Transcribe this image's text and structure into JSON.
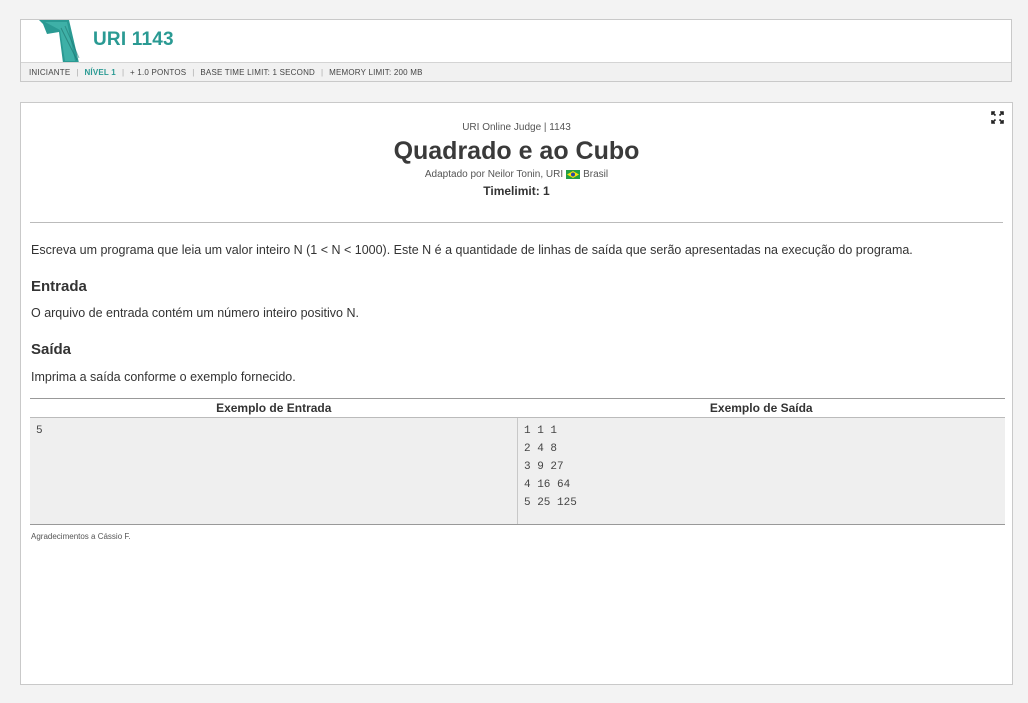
{
  "header": {
    "problem_id": "URI 1143",
    "meta": {
      "category": "INICIANTE",
      "level": "NÍVEL 1",
      "points": "+ 1.0 PONTOS",
      "time_limit": "BASE TIME LIMIT: 1 SECOND",
      "memory_limit": "MEMORY LIMIT: 200 MB"
    },
    "logo_icon": "uri-1-logo"
  },
  "problem": {
    "judge_line": "URI Online Judge | 1143",
    "title": "Quadrado e ao Cubo",
    "author_prefix": "Adaptado por Neilor Tonin, URI",
    "country": "Brasil",
    "flag_icon": "brazil-flag-icon",
    "timelimit": "Timelimit: 1",
    "description": "Escreva um programa que leia um valor inteiro N (1 < N < 1000). Este N é a quantidade de linhas de saída que serão apresentadas na execução do programa.",
    "input_heading": "Entrada",
    "input_text": "O arquivo de entrada contém um número inteiro positivo N.",
    "output_heading": "Saída",
    "output_text": "Imprima a saída conforme o exemplo fornecido.",
    "examples": {
      "input_header": "Exemplo de Entrada",
      "output_header": "Exemplo de Saída",
      "input": "5",
      "output": "1 1 1\n2 4 8\n3 9 27\n4 16 64\n5 25 125"
    },
    "thanks": "Agradecimentos a Cássio F."
  },
  "icons": {
    "expand": "expand-icon"
  },
  "colors": {
    "accent": "#2a9a93",
    "header_bg": "#ffffff",
    "meta_bg": "#f1f1f1",
    "example_bg": "#efefef"
  }
}
